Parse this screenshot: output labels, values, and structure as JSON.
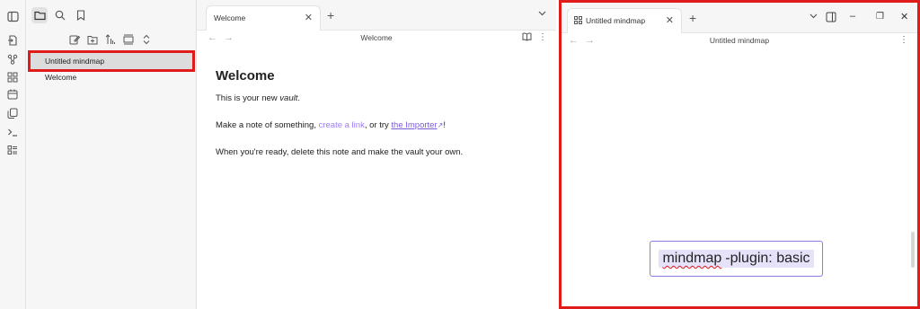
{
  "ribbon": {
    "icons": [
      "toggle-sidebar-icon",
      "open-quick-switcher-icon",
      "graph-view-icon",
      "canvas-icon",
      "daily-note-icon",
      "templates-icon",
      "command-palette-icon",
      "bookmarks-list-icon"
    ]
  },
  "file_explorer": {
    "items": [
      {
        "label": "Untitled mindmap",
        "selected": true
      },
      {
        "label": "Welcome",
        "selected": false
      }
    ]
  },
  "middle_pane": {
    "tab_title": "Welcome",
    "view_title": "Welcome",
    "heading": "Welcome",
    "para1_text": "This is your new ",
    "para1_em": "vault",
    "para1_end": ".",
    "para2_start": "Make a note of something, ",
    "para2_link1": "create a link",
    "para2_middle": ", or try ",
    "para2_link2": "the Importer",
    "para2_end": "!",
    "para3": "When you're ready, delete this note and make the vault your own."
  },
  "right_pane": {
    "tab_title": "Untitled mindmap",
    "view_title": "Untitled mindmap",
    "node_text_a": "mindmap",
    "node_text_b": "-plugin: basic"
  },
  "glyphs": {
    "close": "✕",
    "plus": "+",
    "chevron": "⌄",
    "back": "←",
    "forward": "→",
    "more": "⋮",
    "minimize": "–",
    "restore": "❐",
    "external": "↗"
  },
  "colors": {
    "highlight_border": "#e01b1b",
    "link": "#9c7ff0",
    "node_border": "#8f7be8"
  }
}
